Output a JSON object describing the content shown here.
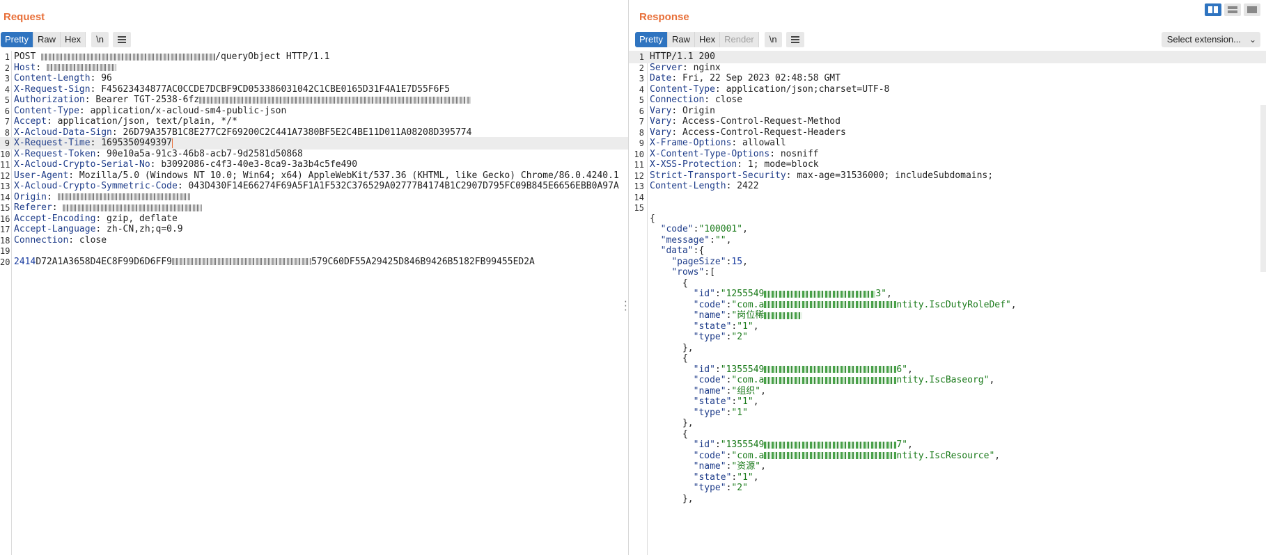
{
  "request": {
    "title": "Request",
    "tabs": [
      "Pretty",
      "Raw",
      "Hex"
    ],
    "newline_label": "\\n",
    "lines": [
      {
        "n": "1",
        "parts": [
          {
            "t": "POST "
          },
          {
            "blur": true,
            "w": 250
          },
          {
            "t": "/queryObject HTTP/1.1"
          }
        ]
      },
      {
        "n": "2",
        "parts": [
          {
            "t": "Host",
            "c": "k"
          },
          {
            "t": ": "
          },
          {
            "blur": true,
            "w": 100
          }
        ]
      },
      {
        "n": "3",
        "parts": [
          {
            "t": "Content-Length",
            "c": "k"
          },
          {
            "t": ": 96"
          }
        ]
      },
      {
        "n": "4",
        "parts": [
          {
            "t": "X-Request-Sign",
            "c": "k"
          },
          {
            "t": ": F45623434877AC0CCDE7DCBF9CD053386031042C1CBE0165D31F4A1E7D55F6F5"
          }
        ]
      },
      {
        "n": "5",
        "parts": [
          {
            "t": "Authorization",
            "c": "k"
          },
          {
            "t": ": Bearer TGT-2538-6fz"
          },
          {
            "blur": true,
            "w": 390
          }
        ]
      },
      {
        "n": "6",
        "parts": [
          {
            "t": "Content-Type",
            "c": "k"
          },
          {
            "t": ": application/x-acloud-sm4-public-json"
          }
        ]
      },
      {
        "n": "7",
        "parts": [
          {
            "t": "Accept",
            "c": "k"
          },
          {
            "t": ": application/json, text/plain, */*"
          }
        ]
      },
      {
        "n": "8",
        "parts": [
          {
            "t": "X-Acloud-Data-Sign",
            "c": "k"
          },
          {
            "t": ": 26D79A357B1C8E277C2F69200C2C441A7380BF5E2C4BE11D011A08208D395774"
          }
        ]
      },
      {
        "n": "9",
        "hl": true,
        "caret": true,
        "parts": [
          {
            "t": "X-Request-Time",
            "c": "k"
          },
          {
            "t": ": 1695350949397"
          }
        ]
      },
      {
        "n": "10",
        "parts": [
          {
            "t": "X-Request-Token",
            "c": "k"
          },
          {
            "t": ": 90e10a5a-91c3-46b8-acb7-9d2581d50868"
          }
        ]
      },
      {
        "n": "11",
        "parts": [
          {
            "t": "X-Acloud-Crypto-Serial-No",
            "c": "k"
          },
          {
            "t": ": b3092086-c4f3-40e3-8ca9-3a3b4c5fe490"
          }
        ]
      },
      {
        "n": "12",
        "parts": [
          {
            "t": "User-Agent",
            "c": "k"
          },
          {
            "t": ": Mozilla/5.0 (Windows NT 10.0; Win64; x64) AppleWebKit/537.36 (KHTML, like Gecko) Chrome/86.0.4240.1"
          }
        ]
      },
      {
        "n": "13",
        "parts": [
          {
            "t": "X-Acloud-Crypto-Symmetric-Code",
            "c": "k"
          },
          {
            "t": ": 043D430F14E66274F69A5F1A1F532C376529A02777B4174B1C2907D795FC09B845E6656EBB0A97A"
          }
        ]
      },
      {
        "n": "14",
        "parts": [
          {
            "t": "Origin",
            "c": "k"
          },
          {
            "t": ": "
          },
          {
            "blur": true,
            "w": 190
          }
        ]
      },
      {
        "n": "15",
        "parts": [
          {
            "t": "Referer",
            "c": "k"
          },
          {
            "t": ": "
          },
          {
            "blur": true,
            "w": 200
          }
        ]
      },
      {
        "n": "16",
        "parts": [
          {
            "t": "Accept-Encoding",
            "c": "k"
          },
          {
            "t": ": gzip, deflate"
          }
        ]
      },
      {
        "n": "17",
        "parts": [
          {
            "t": "Accept-Language",
            "c": "k"
          },
          {
            "t": ": zh-CN,zh;q=0.9"
          }
        ]
      },
      {
        "n": "18",
        "parts": [
          {
            "t": "Connection",
            "c": "k"
          },
          {
            "t": ": close"
          }
        ]
      },
      {
        "n": "19",
        "parts": []
      },
      {
        "n": "20",
        "parts": [
          {
            "t": "2414",
            "c": "n"
          },
          {
            "t": "D72A1A3658D4EC8F99D6D6FF9"
          },
          {
            "blur": true,
            "w": 200
          },
          {
            "t": "579C60DF55A29425D846B9426B5182FB99455ED2A"
          }
        ]
      }
    ]
  },
  "response": {
    "title": "Response",
    "tabs": [
      "Pretty",
      "Raw",
      "Hex",
      "Render"
    ],
    "newline_label": "\\n",
    "select_extension": "Select extension...",
    "lines": [
      {
        "n": "1",
        "hl": true,
        "parts": [
          {
            "t": "HTTP/1.1 200"
          }
        ]
      },
      {
        "n": "2",
        "parts": [
          {
            "t": "Server",
            "c": "k"
          },
          {
            "t": ": nginx"
          }
        ]
      },
      {
        "n": "3",
        "parts": [
          {
            "t": "Date",
            "c": "k"
          },
          {
            "t": ": Fri, 22 Sep 2023 02:48:58 GMT"
          }
        ]
      },
      {
        "n": "4",
        "parts": [
          {
            "t": "Content-Type",
            "c": "k"
          },
          {
            "t": ": application/json;charset=UTF-8"
          }
        ]
      },
      {
        "n": "5",
        "parts": [
          {
            "t": "Connection",
            "c": "k"
          },
          {
            "t": ": close"
          }
        ]
      },
      {
        "n": "6",
        "parts": [
          {
            "t": "Vary",
            "c": "k"
          },
          {
            "t": ": Origin"
          }
        ]
      },
      {
        "n": "7",
        "parts": [
          {
            "t": "Vary",
            "c": "k"
          },
          {
            "t": ": Access-Control-Request-Method"
          }
        ]
      },
      {
        "n": "8",
        "parts": [
          {
            "t": "Vary",
            "c": "k"
          },
          {
            "t": ": Access-Control-Request-Headers"
          }
        ]
      },
      {
        "n": "9",
        "parts": [
          {
            "t": "X-Frame-Options",
            "c": "k"
          },
          {
            "t": ": allowall"
          }
        ]
      },
      {
        "n": "10",
        "parts": [
          {
            "t": "X-Content-Type-Options",
            "c": "k"
          },
          {
            "t": ": nosniff"
          }
        ]
      },
      {
        "n": "11",
        "parts": [
          {
            "t": "X-XSS-Protection",
            "c": "k"
          },
          {
            "t": ": 1; mode=block"
          }
        ]
      },
      {
        "n": "12",
        "parts": [
          {
            "t": "Strict-Transport-Security",
            "c": "k"
          },
          {
            "t": ": max-age=31536000; includeSubdomains;"
          }
        ]
      },
      {
        "n": "13",
        "parts": [
          {
            "t": "Content-Length",
            "c": "k"
          },
          {
            "t": ": 2422"
          }
        ]
      },
      {
        "n": "14",
        "parts": []
      },
      {
        "n": "15",
        "parts": []
      },
      {
        "n": "",
        "parts": [
          {
            "t": "{"
          }
        ]
      },
      {
        "n": "",
        "parts": [
          {
            "t": "  "
          },
          {
            "t": "\"code\"",
            "c": "k"
          },
          {
            "t": ":"
          },
          {
            "t": "\"100001\"",
            "c": "s"
          },
          {
            "t": ","
          }
        ]
      },
      {
        "n": "",
        "parts": [
          {
            "t": "  "
          },
          {
            "t": "\"message\"",
            "c": "k"
          },
          {
            "t": ":"
          },
          {
            "t": "\"\"",
            "c": "s"
          },
          {
            "t": ","
          }
        ]
      },
      {
        "n": "",
        "parts": [
          {
            "t": "  "
          },
          {
            "t": "\"data\"",
            "c": "k"
          },
          {
            "t": ":{"
          }
        ]
      },
      {
        "n": "",
        "parts": [
          {
            "t": "    "
          },
          {
            "t": "\"pageSize\"",
            "c": "k"
          },
          {
            "t": ":"
          },
          {
            "t": "15",
            "c": "n"
          },
          {
            "t": ","
          }
        ]
      },
      {
        "n": "",
        "parts": [
          {
            "t": "    "
          },
          {
            "t": "\"rows\"",
            "c": "k"
          },
          {
            "t": ":["
          }
        ]
      },
      {
        "n": "",
        "parts": [
          {
            "t": "      {"
          }
        ]
      },
      {
        "n": "",
        "parts": [
          {
            "t": "        "
          },
          {
            "t": "\"id\"",
            "c": "k"
          },
          {
            "t": ":"
          },
          {
            "t": "\"1255549",
            "c": "s"
          },
          {
            "blurg": true,
            "w": 160
          },
          {
            "t": "3\"",
            "c": "s"
          },
          {
            "t": ","
          }
        ]
      },
      {
        "n": "",
        "parts": [
          {
            "t": "        "
          },
          {
            "t": "\"code\"",
            "c": "k"
          },
          {
            "t": ":"
          },
          {
            "t": "\"com.a",
            "c": "s"
          },
          {
            "blurg": true,
            "w": 190
          },
          {
            "t": "ntity.IscDutyRoleDef\"",
            "c": "s"
          },
          {
            "t": ","
          }
        ]
      },
      {
        "n": "",
        "parts": [
          {
            "t": "        "
          },
          {
            "t": "\"name\"",
            "c": "k"
          },
          {
            "t": ":"
          },
          {
            "t": "\"岗位稀",
            "c": "s"
          },
          {
            "blurg": true,
            "w": 55
          }
        ]
      },
      {
        "n": "",
        "parts": [
          {
            "t": "        "
          },
          {
            "t": "\"state\"",
            "c": "k"
          },
          {
            "t": ":"
          },
          {
            "t": "\"1\"",
            "c": "s"
          },
          {
            "t": ","
          }
        ]
      },
      {
        "n": "",
        "parts": [
          {
            "t": "        "
          },
          {
            "t": "\"type\"",
            "c": "k"
          },
          {
            "t": ":"
          },
          {
            "t": "\"2\"",
            "c": "s"
          }
        ]
      },
      {
        "n": "",
        "parts": [
          {
            "t": "      },"
          }
        ]
      },
      {
        "n": "",
        "parts": [
          {
            "t": "      {"
          }
        ]
      },
      {
        "n": "",
        "parts": [
          {
            "t": "        "
          },
          {
            "t": "\"id\"",
            "c": "k"
          },
          {
            "t": ":"
          },
          {
            "t": "\"1355549",
            "c": "s"
          },
          {
            "blurg": true,
            "w": 190
          },
          {
            "t": "6\"",
            "c": "s"
          },
          {
            "t": ","
          }
        ]
      },
      {
        "n": "",
        "parts": [
          {
            "t": "        "
          },
          {
            "t": "\"code\"",
            "c": "k"
          },
          {
            "t": ":"
          },
          {
            "t": "\"com.a",
            "c": "s"
          },
          {
            "blurg": true,
            "w": 190
          },
          {
            "t": "ntity.IscBaseorg\"",
            "c": "s"
          },
          {
            "t": ","
          }
        ]
      },
      {
        "n": "",
        "parts": [
          {
            "t": "        "
          },
          {
            "t": "\"name\"",
            "c": "k"
          },
          {
            "t": ":"
          },
          {
            "t": "\"组织\"",
            "c": "s"
          },
          {
            "t": ","
          }
        ]
      },
      {
        "n": "",
        "parts": [
          {
            "t": "        "
          },
          {
            "t": "\"state\"",
            "c": "k"
          },
          {
            "t": ":"
          },
          {
            "t": "\"1\"",
            "c": "s"
          },
          {
            "t": ","
          }
        ]
      },
      {
        "n": "",
        "parts": [
          {
            "t": "        "
          },
          {
            "t": "\"type\"",
            "c": "k"
          },
          {
            "t": ":"
          },
          {
            "t": "\"1\"",
            "c": "s"
          }
        ]
      },
      {
        "n": "",
        "parts": [
          {
            "t": "      },"
          }
        ]
      },
      {
        "n": "",
        "parts": [
          {
            "t": "      {"
          }
        ]
      },
      {
        "n": "",
        "parts": [
          {
            "t": "        "
          },
          {
            "t": "\"id\"",
            "c": "k"
          },
          {
            "t": ":"
          },
          {
            "t": "\"1355549",
            "c": "s"
          },
          {
            "blurg": true,
            "w": 190
          },
          {
            "t": "7\"",
            "c": "s"
          },
          {
            "t": ","
          }
        ]
      },
      {
        "n": "",
        "parts": [
          {
            "t": "        "
          },
          {
            "t": "\"code\"",
            "c": "k"
          },
          {
            "t": ":"
          },
          {
            "t": "\"com.a",
            "c": "s"
          },
          {
            "blurg": true,
            "w": 190
          },
          {
            "t": "ntity.IscResource\"",
            "c": "s"
          },
          {
            "t": ","
          }
        ]
      },
      {
        "n": "",
        "parts": [
          {
            "t": "        "
          },
          {
            "t": "\"name\"",
            "c": "k"
          },
          {
            "t": ":"
          },
          {
            "t": "\"资源\"",
            "c": "s"
          },
          {
            "t": ","
          }
        ]
      },
      {
        "n": "",
        "parts": [
          {
            "t": "        "
          },
          {
            "t": "\"state\"",
            "c": "k"
          },
          {
            "t": ":"
          },
          {
            "t": "\"1\"",
            "c": "s"
          },
          {
            "t": ","
          }
        ]
      },
      {
        "n": "",
        "parts": [
          {
            "t": "        "
          },
          {
            "t": "\"type\"",
            "c": "k"
          },
          {
            "t": ":"
          },
          {
            "t": "\"2\"",
            "c": "s"
          }
        ]
      },
      {
        "n": "",
        "parts": [
          {
            "t": "      },"
          }
        ]
      }
    ]
  },
  "colors": {
    "accent": "#e8703a",
    "tab_active": "#2f74c0",
    "key": "#1f3d8a",
    "string": "#1a7a1a"
  }
}
